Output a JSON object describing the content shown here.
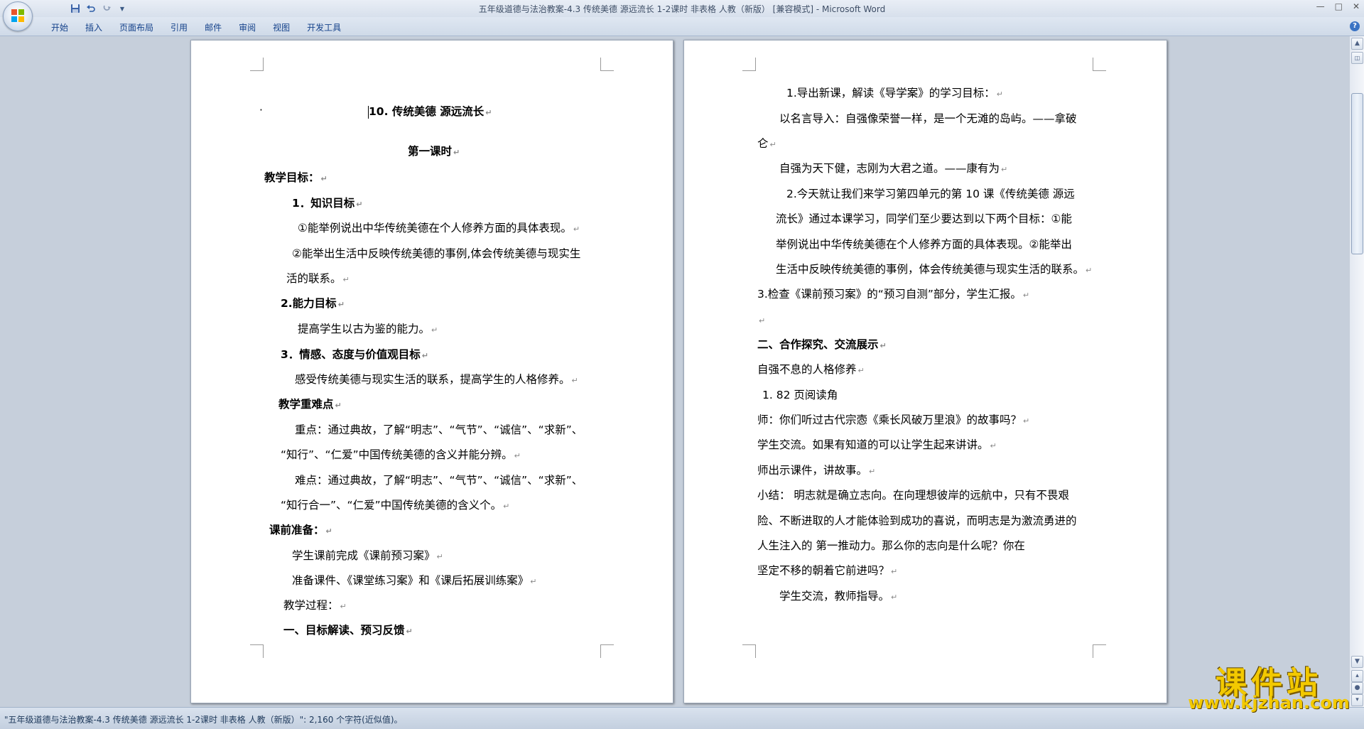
{
  "window": {
    "title": "五年级道德与法治教案-4.3 传统美德  源远流长 1-2课时 非表格 人教（新版） [兼容模式] - Microsoft Word",
    "controls": [
      "—",
      "□",
      "✕"
    ]
  },
  "qat": {
    "save_icon": "save-icon",
    "undo_icon": "undo-icon",
    "redo_icon": "redo-icon",
    "customize_icon": "customize-icon"
  },
  "ribbon": {
    "tabs": [
      "开始",
      "插入",
      "页面布局",
      "引用",
      "邮件",
      "审阅",
      "视图",
      "开发工具"
    ],
    "help": "?"
  },
  "page1": {
    "bullet": "·",
    "title": "10. 传统美德   源远流长",
    "subtitle": "第一课时",
    "goals_heading": "教学目标：",
    "knowledge": "1．知识目标",
    "k1": "①能举例说出中华传统美德在个人修养方面的具体表现。",
    "k2a": "②能举出生活中反映传统美德的事例,体会传统美德与现实生",
    "k2b": "活的联系。",
    "ability": "2.能力目标",
    "ability_text": "提高学生以古为鉴的能力。",
    "emotion": "3．情感、态度与价值观目标",
    "emotion_text": "感受传统美德与现实生活的联系，提高学生的人格修养。",
    "key_heading": "教学重难点",
    "key1a": "重点：通过典故，了解“明志”、“气节”、“诚信”、“求新”、",
    "key1b": "“知行”、“仁爱”中国传统美德的含义并能分辨。",
    "key2a": "难点：通过典故，了解“明志”、“气节”、“诚信”、“求新”、",
    "key2b": "“知行合一”、“仁爱”中国传统美德的含义个。",
    "prep_heading": "课前准备：",
    "prep1": "学生课前完成《课前预习案》",
    "prep2": "准备课件、《课堂练习案》和《课后拓展训练案》",
    "process": "教学过程：",
    "section1": "一、目标解读、预习反馈"
  },
  "page2": {
    "l1": "1.导出新课，解读《导学案》的学习目标：",
    "l2a": "以名言导入：自强像荣誉一样，是一个无滩的岛屿。——拿破",
    "l2b": "仑",
    "l3": "自强为天下健，志刚为大君之道。——康有为",
    "l4a": "2.今天就让我们来学习第四单元的第 10 课《传统美德   源远",
    "l4b": "流长》通过本课学习，同学们至少要达到以下两个目标：①能",
    "l4c": "举例说出中华传统美德在个人修养方面的具体表现。②能举出",
    "l4d": "生活中反映传统美德的事例，体会传统美德与现实生活的联系。",
    "l5": "3.检查《课前预习案》的“预习自测”部分，学生汇报。",
    "section2": "二、合作探究、交流展示",
    "l6": "自强不息的人格修养",
    "l7": "1.  82 页阅读角",
    "l8": "师：你们听过古代宗悫《乘长风破万里浪》的故事吗？",
    "l9": "学生交流。如果有知道的可以让学生起来讲讲。",
    "l10": "师出示课件，讲故事。",
    "l11a": "小结：  明志就是确立志向。在向理想彼岸的远航中，只有不畏艰",
    "l11b": "险、不断进取的人才能体验到成功的喜说，而明志是为激流勇进的",
    "l11c": "人生注入的              第一推动力。那么你的志向是什么呢？你在",
    "l11d": "坚定不移的朝着它前进吗？",
    "l12": "学生交流，教师指导。"
  },
  "pilcrow": "↵",
  "status": {
    "text": "\"五年级道德与法治教案-4.3 传统美德  源远流长 1-2课时 非表格 人教（新版）\": 2,160 个字符(近似值)。"
  },
  "watermark": {
    "cn": "课件站",
    "url": "www.kjzhan.com"
  },
  "colors": {
    "workspace": "#c6cfdb",
    "tab_text": "#15428b",
    "watermark": "#f3c900"
  }
}
